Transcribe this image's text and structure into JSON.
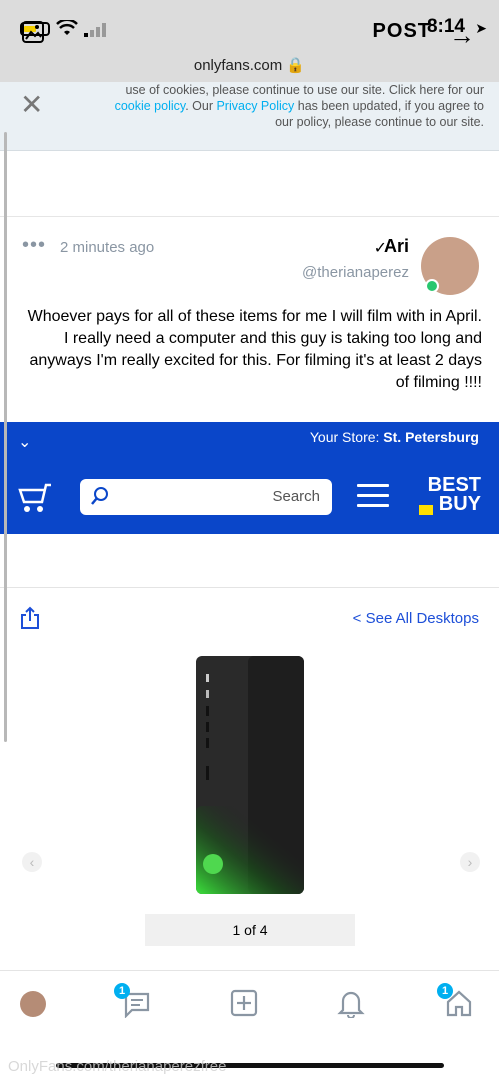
{
  "status_bar": {
    "time": "8:14"
  },
  "browser": {
    "url": "onlyfans.com"
  },
  "cookie_banner": {
    "line1": "use of cookies, please continue to use our site. Click here for our",
    "line2a": "cookie policy",
    "line2b": ". Our ",
    "line2c": "Privacy Policy",
    "line2d": " has been updated, if you agree to",
    "line3": "our policy, please continue to our site."
  },
  "post_header": {
    "title": "POST"
  },
  "author": {
    "name": "Ari",
    "handle": "@therianaperez",
    "time": "2 minutes ago",
    "more": "•••"
  },
  "post": {
    "text": "Whoever pays for all of these items for me I will film with in April. I really need a computer and this guy is taking too long and anyways I'm really excited for this. For filming it's at least 2 days of filming !!!!"
  },
  "bestbuy": {
    "store_label": "Your Store: ",
    "store_name": "St. Petersburg",
    "logo_line1": "BEST",
    "logo_line2": "BUY",
    "search_placeholder": "Search",
    "see_all": "< See All Desktops",
    "pager": "1 of 4"
  },
  "bottom_nav": {
    "messages_badge": "1",
    "home_badge": "1"
  },
  "watermark": "OnlyFans.com/therianaperezfree",
  "colors": {
    "accent": "#00aff0",
    "bestbuy_blue": "#0a46c9",
    "bestbuy_yellow": "#ffe000"
  }
}
